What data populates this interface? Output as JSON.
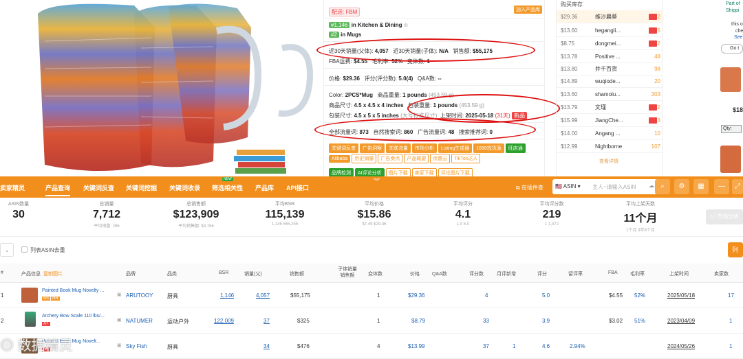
{
  "product_panel": {
    "sold_by_badge": "配送: FBM",
    "add_to_store": "加入产品库",
    "rank1_num": "#1,146",
    "rank1_in": "in",
    "rank1_cat": "Kitchen & Dining",
    "rank2_num": "#2",
    "rank2_in": "in",
    "rank2_cat": "Mugs",
    "sales30_parent_label": "近30天销量(父体):",
    "sales30_parent_value": "4,057",
    "sales30_child_label": "近30天销量(子体):",
    "sales30_child_value": "N/A",
    "revenue_label": "销售额:",
    "revenue_value": "$55,175",
    "fba_label": "FBA运费:",
    "fba_value": "$4.55",
    "margin_label": "毛利率:",
    "margin_value": "52%",
    "variants_label": "变体数:",
    "variants_value": "1",
    "price_label": "价格:",
    "price_value": "$29.36",
    "rating_label": "评分(评分数):",
    "rating_value": "5.0(4)",
    "qa_label": "Q&A数:",
    "qa_value": "--",
    "color_label": "Color:",
    "color_value": "2PCS*Mug",
    "weight_label": "商品重量:",
    "weight_value": "1 pounds",
    "weight_grams": "(453.59 g)",
    "dims_label": "商品尺寸:",
    "dims_value": "4.5 x 4.5 x 4 inches",
    "pkg_weight_label": "包装重量:",
    "pkg_weight_value": "1 pounds",
    "pkg_weight_grams": "(453.59 g)",
    "pkg_dims_label": "包装尺寸:",
    "pkg_dims_value": "4.5 x 5 x 5 inches",
    "pkg_dims_extra": "(大号标准尺寸)",
    "launch_label": "上架时间:",
    "launch_value": "2025-05-18",
    "launch_age": "(31天)",
    "launch_badge": "新品",
    "traffic_total_label": "全部流量词:",
    "traffic_total_value": "873",
    "traffic_organic_label": "自然搜索词:",
    "traffic_organic_value": "860",
    "traffic_ad_label": "广告流量词:",
    "traffic_ad_value": "48",
    "traffic_rec_label": "搜索推荐词:",
    "traffic_rec_value": "0",
    "tags_row1": [
      "关键词反查",
      "广告洞察",
      "关联流量",
      "市场分析",
      "Listing生成器",
      "1688找货源",
      "旺店通"
    ],
    "tags_row2": [
      "Alibaba",
      "历史销量",
      "广告卖点",
      "产品概要",
      "优惠云",
      "TikTok达人"
    ],
    "buttons": [
      "品牌检测",
      "AI评论分析",
      "图片下载",
      "卖家下载",
      "评论图片下载"
    ]
  },
  "seller_panel": {
    "header": "购买库存",
    "rows": [
      {
        "price": "$29.36",
        "name": "维沙晨葵",
        "qty": "2"
      },
      {
        "price": "$13.60",
        "name": "hegangli...",
        "qty": "5"
      },
      {
        "price": "$8.75",
        "name": "dongmei...",
        "qty": "2"
      },
      {
        "price": "$13.78",
        "name": "Positive ...",
        "qty": "48"
      },
      {
        "price": "$13.80",
        "name": "井千百货",
        "qty": "98"
      },
      {
        "price": "$14.89",
        "name": "wuqiode...",
        "qty": "20"
      },
      {
        "price": "$13.60",
        "name": "shamolu...",
        "qty": "303"
      },
      {
        "price": "$13.79",
        "name": "文瑾",
        "qty": "2"
      },
      {
        "price": "$15.99",
        "name": "JiangChe...",
        "qty": "3"
      },
      {
        "price": "$14.00",
        "name": "Angang ...",
        "qty": "10"
      },
      {
        "price": "$12.99",
        "name": "Nightborne",
        "qty": "107"
      }
    ],
    "more": "查看详情"
  },
  "right_panel": {
    "line1": "Part of",
    "line2": "Shippi",
    "line3": "this o",
    "line4": "che",
    "line5": "See",
    "go": "Go t",
    "price": "$18",
    "qty": "Qty:"
  },
  "nav": {
    "brand": "卖家精灵",
    "items": [
      "产品查询",
      "关键词反查",
      "关键词挖掘",
      "关键词收录",
      "筛选相关性",
      "产品库",
      "API接口"
    ],
    "new_badge": "NEW",
    "open_new": "在插件查",
    "marketplace": "ASIN",
    "search_placeholder": "主人~请输入ASIN"
  },
  "stats": [
    {
      "label": "ASIN数量",
      "value": "30",
      "sub": ""
    },
    {
      "label": "总销量",
      "value": "7,712",
      "sub": "平均销量: 286"
    },
    {
      "label": "总销售额",
      "value": "$123,909",
      "sub": "平均销售额: $4,766"
    },
    {
      "label": "平均BSR",
      "value": "115,139",
      "sub": "1,146   565,255"
    },
    {
      "label": "平均价格",
      "value": "$15.86",
      "sub": "$7.49   $29.36"
    },
    {
      "label": "平均评分",
      "value": "4.1",
      "sub": "1.0   5.0"
    },
    {
      "label": "平均评分数",
      "value": "219",
      "sub": "1   1,472"
    },
    {
      "label": "平均上架天数",
      "value": "11个月",
      "sub": "1个月   3年8个月"
    }
  ],
  "market_btn": "市场分析",
  "list_btn": "列表",
  "dedupe_label": "列表ASIN去重",
  "table": {
    "headers": [
      "#",
      "产品信息",
      "品牌",
      "品类",
      "BSR",
      "销量(父)",
      "销售额",
      "子体销量销售额",
      "变体数",
      "价格",
      "Q&A数",
      "评分数",
      "月评新增",
      "评分",
      "留评率",
      "FBA",
      "毛利率",
      "上架时间",
      "卖家数"
    ],
    "export_label": "复制图片",
    "rows": [
      {
        "idx": "1",
        "title": "Painted Book Mug Novelty ...",
        "brand": "ARUTOOY",
        "cat": "厨具",
        "bsr": "1,146",
        "sales": "4,057",
        "revenue": "$55,175",
        "variants": "1",
        "price": "$29.36",
        "qa": "",
        "ratings": "4",
        "monthly": "",
        "rating": "5.0",
        "review_rate": "",
        "fba": "$4.55",
        "margin": "52%",
        "date": "2025/05/18",
        "sellers": "17"
      },
      {
        "idx": "2",
        "title": "Archery Bow Scale 110 lbs/...",
        "brand": "NATUMER",
        "cat": "运动户外",
        "bsr": "122,009",
        "sales": "37",
        "revenue": "$325",
        "variants": "1",
        "price": "$8.79",
        "qa": "",
        "ratings": "33",
        "monthly": "",
        "rating": "3.9",
        "review_rate": "",
        "fba": "$3.02",
        "margin": "51%",
        "date": "2023/04/09",
        "sellers": "1"
      },
      {
        "idx": "3",
        "title": "Painted Book Mug Novelt...",
        "brand": "Sky Fish",
        "cat": "厨具",
        "bsr": "",
        "sales": "34",
        "revenue": "$476",
        "variants": "4",
        "price": "$13.99",
        "qa": "",
        "ratings": "37",
        "monthly": "1",
        "rating": "4.6",
        "review_rate": "2.94%",
        "fba": "",
        "margin": "",
        "date": "2024/05/26",
        "sellers": "1"
      }
    ]
  },
  "watermark": "数据精灵"
}
